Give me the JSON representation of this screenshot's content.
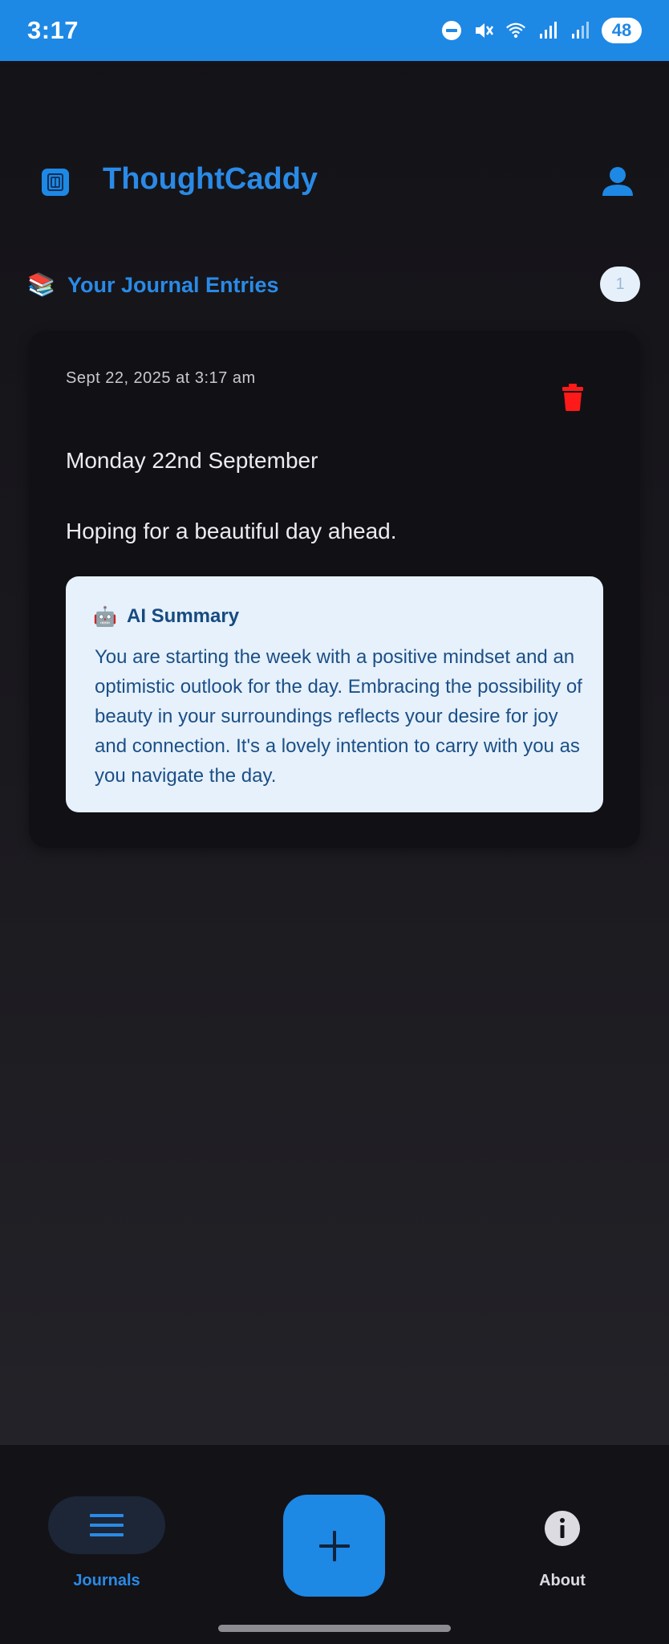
{
  "status_bar": {
    "time": "3:17",
    "battery": "48",
    "icons": [
      "do-not-disturb-icon",
      "mute-icon",
      "wifi-icon",
      "signal-icon",
      "signal-icon"
    ]
  },
  "header": {
    "app_title": "ThoughtCaddy",
    "logo_icon": "journal-icon",
    "profile_icon": "user-icon"
  },
  "section": {
    "emoji": "📚",
    "title": "Your Journal Entries",
    "count": "1"
  },
  "entries": [
    {
      "date": "Sept 22, 2025 at 3:17 am",
      "title": "Monday 22nd September",
      "body": "Hoping for a beautiful day ahead.",
      "ai_summary": {
        "emoji": "🤖",
        "title": "AI Summary",
        "text": "You are starting the week with a positive mindset and an optimistic outlook for the day. Embracing the possibility of beauty in your surroundings reflects your desire for joy and connection. It's a lovely intention to carry with you as you navigate the day."
      }
    }
  ],
  "bottom_nav": {
    "journals_label": "Journals",
    "about_label": "About"
  },
  "colors": {
    "accent": "#1e88e5",
    "delete": "#ff1a1a",
    "summary_bg": "#e6f1fc"
  }
}
